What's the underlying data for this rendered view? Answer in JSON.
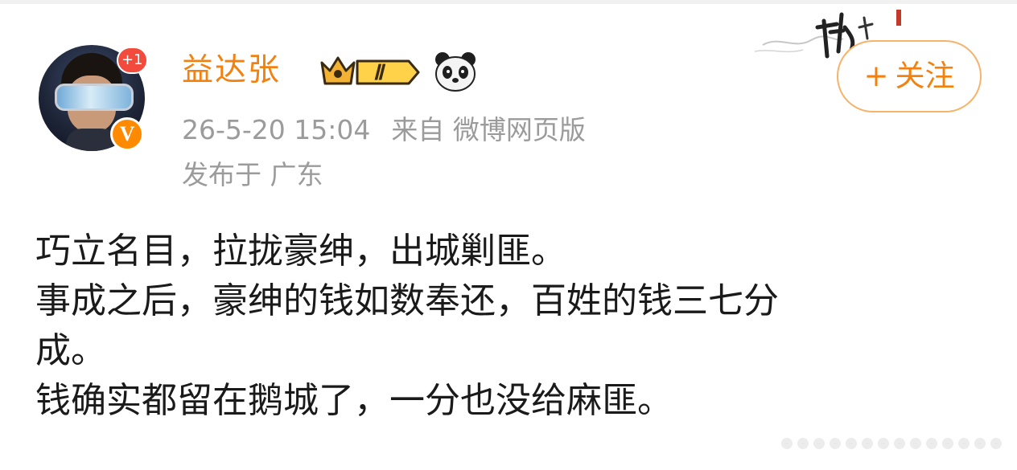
{
  "post": {
    "author": {
      "name": "益达张",
      "avatar_badge": "+1",
      "verified_mark": "V",
      "level_badge": "Ⅱ",
      "emoji": "panda-icon"
    },
    "follow_button": {
      "plus": "+",
      "label": "关注"
    },
    "meta": {
      "time": "26-5-20 15:04",
      "source": "来自 微博网页版",
      "location": "发布于 广东"
    },
    "content": {
      "lines": [
        "巧立名目，拉拢豪绅，出城剿匪。",
        "事成之后，豪绅的钱如数奉还，百姓的钱三七分",
        "成。",
        "钱确实都留在鹅城了，一分也没给麻匪。"
      ]
    }
  },
  "colors": {
    "accent": "#f2810f",
    "follow_border": "#f7b26b",
    "meta_text": "#9b9b9b",
    "badge_red": "#f24b3d",
    "verified_orange": "#ff8a00",
    "body_text": "#1a1a1a"
  }
}
